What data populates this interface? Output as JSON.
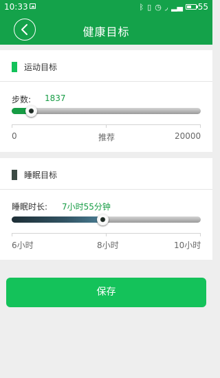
{
  "statusbar": {
    "time": "10:33",
    "battery_level": "55"
  },
  "header": {
    "title": "健康目标"
  },
  "exercise": {
    "section_title": "运动目标",
    "steps_label": "步数:",
    "steps_value": "1837",
    "slider_progress": 0.1,
    "scale_labels": [
      "0",
      "推荐",
      "20000"
    ],
    "marker_color": "#13c25a"
  },
  "sleep": {
    "section_title": "睡眠目标",
    "duration_label": "睡眠时长:",
    "duration_value": "7小时55分钟",
    "slider_progress": 0.48,
    "scale_labels": [
      "6小时",
      "8小时",
      "10小时"
    ],
    "marker_color": "#3c4b45"
  },
  "save_label": "保存",
  "colors": {
    "header": "#14a24a",
    "accent_text": "#169c44",
    "button": "#14c25a"
  }
}
